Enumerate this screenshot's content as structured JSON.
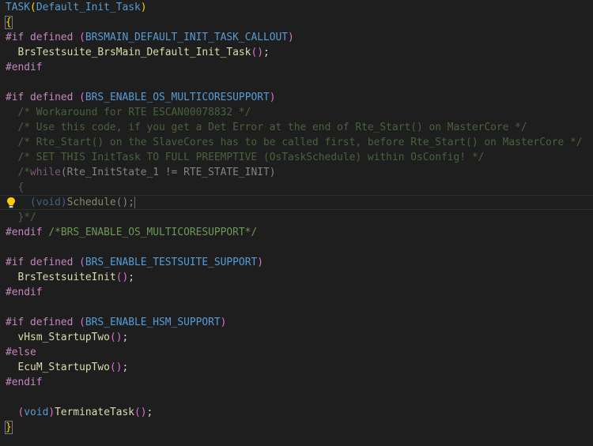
{
  "editor": {
    "lines": [
      {
        "id": "l1",
        "segments": [
          {
            "cls": "keyword",
            "text": "TASK"
          },
          {
            "cls": "brace-gold",
            "text": "("
          },
          {
            "cls": "keyword",
            "text": "Default_Init_Task"
          },
          {
            "cls": "brace-gold",
            "text": ")"
          }
        ]
      },
      {
        "id": "l2",
        "segments": [
          {
            "cls": "brace-match",
            "text": "{"
          }
        ]
      },
      {
        "id": "l3",
        "segments": [
          {
            "cls": "preproc",
            "text": "#if defined "
          },
          {
            "cls": "paren-pink",
            "text": "("
          },
          {
            "cls": "keyword",
            "text": "BRSMAIN_DEFAULT_INIT_TASK_CALLOUT"
          },
          {
            "cls": "paren-pink",
            "text": ")"
          }
        ]
      },
      {
        "id": "l4",
        "segments": [
          {
            "cls": "plain",
            "text": "  "
          },
          {
            "cls": "func",
            "text": "BrsTestsuite_BrsMain_Default_Init_Task"
          },
          {
            "cls": "paren-pink",
            "text": "()"
          },
          {
            "cls": "plain",
            "text": ";"
          }
        ]
      },
      {
        "id": "l5",
        "segments": [
          {
            "cls": "preproc",
            "text": "#endif"
          }
        ]
      },
      {
        "id": "l6",
        "segments": []
      },
      {
        "id": "l7",
        "segments": [
          {
            "cls": "preproc",
            "text": "#if defined "
          },
          {
            "cls": "paren-pink",
            "text": "("
          },
          {
            "cls": "keyword",
            "text": "BRS_ENABLE_OS_MULTICORESUPPORT"
          },
          {
            "cls": "paren-pink",
            "text": ")"
          }
        ]
      },
      {
        "id": "l8",
        "dim": true,
        "segments": [
          {
            "cls": "comment",
            "text": "  /* Workaround for RTE ESCAN00078832 */"
          }
        ]
      },
      {
        "id": "l9",
        "dim": true,
        "segments": [
          {
            "cls": "comment",
            "text": "  /* Use this code, if you get a Det Error at the end of Rte_Start() on MasterCore */"
          }
        ]
      },
      {
        "id": "l10",
        "dim": true,
        "segments": [
          {
            "cls": "comment",
            "text": "  /* Rte_Start() on the SlaveCores has to be called first, before Rte_Start() on MasterCore */"
          }
        ]
      },
      {
        "id": "l11",
        "dim": true,
        "segments": [
          {
            "cls": "comment",
            "text": "  /* SET THIS InitTask TO FULL PREEMPTIVE (OsTaskSchedule) within OsConfig! */"
          }
        ]
      },
      {
        "id": "l12",
        "dim": true,
        "segments": [
          {
            "cls": "comment",
            "text": "  /*"
          },
          {
            "cls": "preproc",
            "text": "while"
          },
          {
            "cls": "plain",
            "text": "(Rte_InitState_1 != RTE_STATE_INIT)"
          }
        ]
      },
      {
        "id": "l13",
        "dim": true,
        "segments": [
          {
            "cls": "comment",
            "text": "  {"
          }
        ]
      },
      {
        "id": "l14",
        "dim": true,
        "current": true,
        "bulb": true,
        "segments": [
          {
            "cls": "plain",
            "text": "    "
          },
          {
            "cls": "keyword",
            "text": "(void)"
          },
          {
            "cls": "func",
            "text": "Schedule"
          },
          {
            "cls": "plain",
            "text": "();"
          }
        ]
      },
      {
        "id": "l15",
        "dim": true,
        "segments": [
          {
            "cls": "comment",
            "text": "  }*/"
          }
        ]
      },
      {
        "id": "l16",
        "segments": [
          {
            "cls": "preproc",
            "text": "#endif "
          },
          {
            "cls": "comment",
            "text": "/*BRS_ENABLE_OS_MULTICORESUPPORT*/"
          }
        ]
      },
      {
        "id": "l17",
        "segments": []
      },
      {
        "id": "l18",
        "segments": [
          {
            "cls": "preproc",
            "text": "#if defined "
          },
          {
            "cls": "paren-pink",
            "text": "("
          },
          {
            "cls": "keyword",
            "text": "BRS_ENABLE_TESTSUITE_SUPPORT"
          },
          {
            "cls": "paren-pink",
            "text": ")"
          }
        ]
      },
      {
        "id": "l19",
        "segments": [
          {
            "cls": "plain",
            "text": "  "
          },
          {
            "cls": "func",
            "text": "BrsTestsuiteInit"
          },
          {
            "cls": "paren-pink",
            "text": "()"
          },
          {
            "cls": "plain",
            "text": ";"
          }
        ]
      },
      {
        "id": "l20",
        "segments": [
          {
            "cls": "preproc",
            "text": "#endif"
          }
        ]
      },
      {
        "id": "l21",
        "segments": []
      },
      {
        "id": "l22",
        "segments": [
          {
            "cls": "preproc",
            "text": "#if defined "
          },
          {
            "cls": "paren-pink",
            "text": "("
          },
          {
            "cls": "keyword",
            "text": "BRS_ENABLE_HSM_SUPPORT"
          },
          {
            "cls": "paren-pink",
            "text": ")"
          }
        ]
      },
      {
        "id": "l23",
        "segments": [
          {
            "cls": "plain",
            "text": "  "
          },
          {
            "cls": "func",
            "text": "vHsm_StartupTwo"
          },
          {
            "cls": "paren-pink",
            "text": "()"
          },
          {
            "cls": "plain",
            "text": ";"
          }
        ]
      },
      {
        "id": "l24",
        "segments": [
          {
            "cls": "preproc",
            "text": "#else"
          }
        ]
      },
      {
        "id": "l25",
        "segments": [
          {
            "cls": "plain",
            "text": "  "
          },
          {
            "cls": "func",
            "text": "EcuM_StartupTwo"
          },
          {
            "cls": "paren-pink",
            "text": "()"
          },
          {
            "cls": "plain",
            "text": ";"
          }
        ]
      },
      {
        "id": "l26",
        "segments": [
          {
            "cls": "preproc",
            "text": "#endif"
          }
        ]
      },
      {
        "id": "l27",
        "segments": []
      },
      {
        "id": "l28",
        "segments": [
          {
            "cls": "plain",
            "text": "  "
          },
          {
            "cls": "paren-pink",
            "text": "("
          },
          {
            "cls": "keyword",
            "text": "void"
          },
          {
            "cls": "paren-pink",
            "text": ")"
          },
          {
            "cls": "func",
            "text": "TerminateTask"
          },
          {
            "cls": "paren-pink",
            "text": "()"
          },
          {
            "cls": "plain",
            "text": ";"
          }
        ]
      },
      {
        "id": "l29",
        "segments": [
          {
            "cls": "brace-match",
            "text": "}"
          }
        ]
      }
    ]
  }
}
